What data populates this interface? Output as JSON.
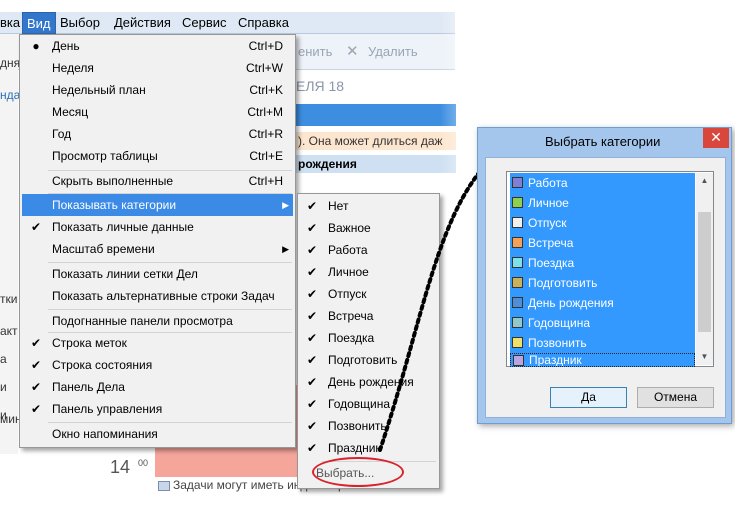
{
  "menubar": {
    "items": [
      "вка",
      "Вид",
      "Выбор",
      "Действия",
      "Сервис",
      "Справка"
    ]
  },
  "toolbar": {
    "action1_label": "енить",
    "delete_label": "Удалить"
  },
  "background": {
    "left_fragments": [
      "дня",
      "нда",
      "тки",
      "акт",
      "а",
      "и",
      "и",
      "мина"
    ],
    "date_header": "ЕЛЯ 18",
    "appointment_text": "). Она может длиться даж",
    "birthday_text": "рождения",
    "time_hour": "14",
    "time_minutes": "00",
    "task_hint": "Задачи могут иметь индикатор выполнения"
  },
  "view_menu": {
    "items": [
      {
        "label": "День",
        "shortcut": "Ctrl+D",
        "mark": "bullet"
      },
      {
        "label": "Неделя",
        "shortcut": "Ctrl+W",
        "mark": ""
      },
      {
        "label": "Недельный план",
        "shortcut": "Ctrl+K",
        "mark": ""
      },
      {
        "label": "Месяц",
        "shortcut": "Ctrl+M",
        "mark": ""
      },
      {
        "label": "Год",
        "shortcut": "Ctrl+R",
        "mark": ""
      },
      {
        "label": "Просмотр таблицы",
        "shortcut": "Ctrl+E",
        "mark": ""
      },
      {
        "label": "Скрыть выполненные",
        "shortcut": "Ctrl+H",
        "mark": ""
      },
      {
        "label": "Показывать категории",
        "shortcut": "",
        "mark": "",
        "submenu": true
      },
      {
        "label": "Показать личные данные",
        "shortcut": "",
        "mark": "check"
      },
      {
        "label": "Масштаб времени",
        "shortcut": "",
        "mark": "",
        "submenu": true
      },
      {
        "label": "Показать линии сетки Дел",
        "shortcut": "",
        "mark": ""
      },
      {
        "label": "Показать альтернативные строки Задач",
        "shortcut": "",
        "mark": ""
      },
      {
        "label": "Подогнанные панели просмотра",
        "shortcut": "",
        "mark": ""
      },
      {
        "label": "Строка меток",
        "shortcut": "",
        "mark": "check"
      },
      {
        "label": "Строка состояния",
        "shortcut": "",
        "mark": "check"
      },
      {
        "label": "Панель Дела",
        "shortcut": "",
        "mark": "check"
      },
      {
        "label": "Панель управления",
        "shortcut": "",
        "mark": "check"
      },
      {
        "label": "Окно напоминания",
        "shortcut": "",
        "mark": ""
      }
    ]
  },
  "categories_submenu": {
    "items": [
      {
        "label": "Нет",
        "checked": true
      },
      {
        "label": "Важное",
        "checked": true
      },
      {
        "label": "Работа",
        "checked": true
      },
      {
        "label": "Личное",
        "checked": true
      },
      {
        "label": "Отпуск",
        "checked": true
      },
      {
        "label": "Встреча",
        "checked": true
      },
      {
        "label": "Поездка",
        "checked": true
      },
      {
        "label": "Подготовить",
        "checked": true
      },
      {
        "label": "День рождения",
        "checked": true
      },
      {
        "label": "Годовщина",
        "checked": true
      },
      {
        "label": "Позвонить",
        "checked": true
      },
      {
        "label": "Праздник",
        "checked": true
      }
    ],
    "choose_label": "Выбрать..."
  },
  "dialog": {
    "title": "Выбрать категории",
    "close_glyph": "✕",
    "categories": [
      {
        "label": "Работа",
        "color": "#7f7fd4"
      },
      {
        "label": "Личное",
        "color": "#8fd14f"
      },
      {
        "label": "Отпуск",
        "color": "#f0f0f0"
      },
      {
        "label": "Встреча",
        "color": "#f5a158"
      },
      {
        "label": "Поездка",
        "color": "#7fe0e8"
      },
      {
        "label": "Подготовить",
        "color": "#c9b25a"
      },
      {
        "label": "День рождения",
        "color": "#4f8fd8"
      },
      {
        "label": "Годовщина",
        "color": "#8fc9c9"
      },
      {
        "label": "Позвонить",
        "color": "#f0e06a"
      },
      {
        "label": "Праздник",
        "color": "#b9a5e0"
      }
    ],
    "ok_label": "Да",
    "cancel_label": "Отмена"
  },
  "colors": {
    "highlight": "#3b8ae6",
    "list_selection": "#3399ff",
    "dialog_frame": "#a4c6ed",
    "close_button": "#d9463b",
    "ellipse": "#d9222a"
  }
}
